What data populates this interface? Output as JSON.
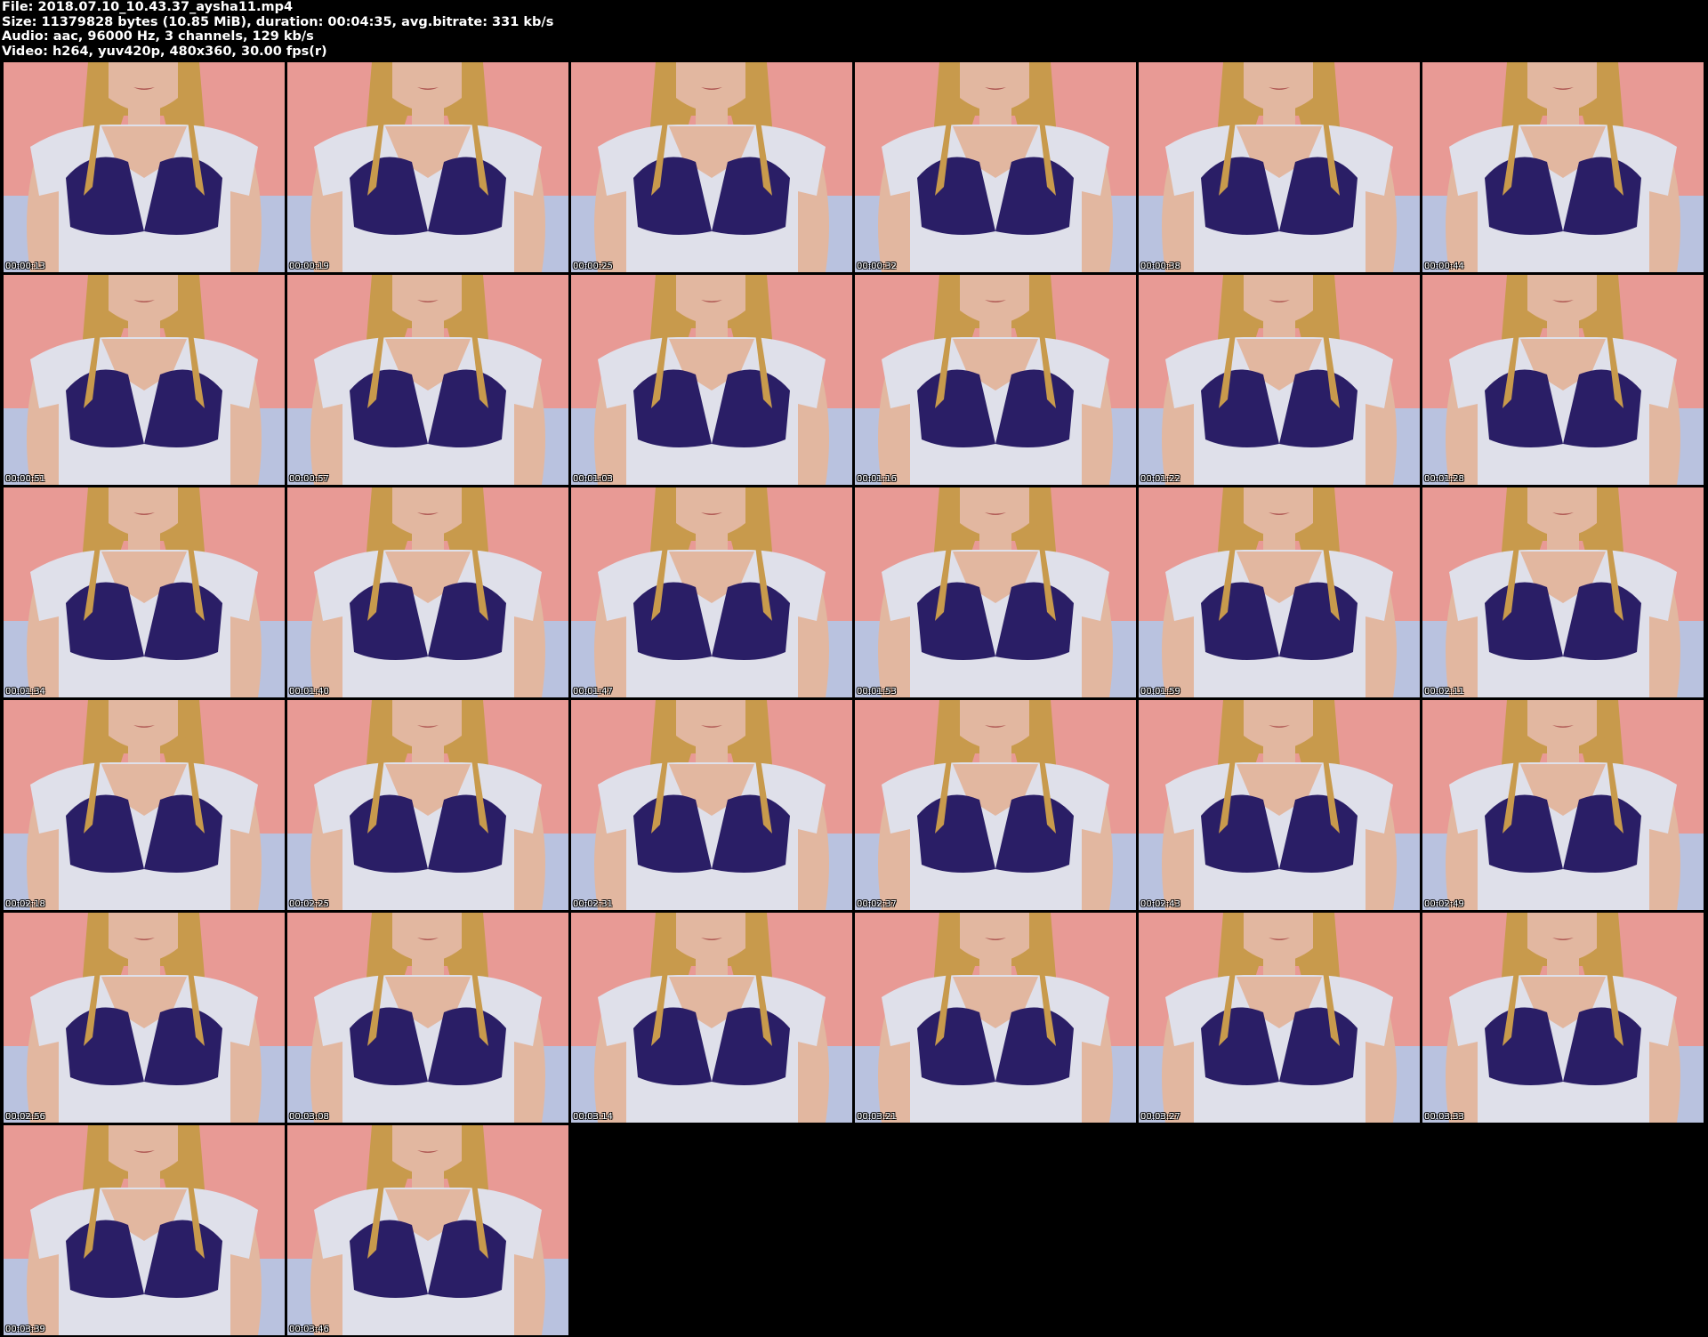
{
  "header": {
    "file_line": "File: 2018.07.10_10.43.37_aysha11.mp4",
    "size_line": "Size: 11379828 bytes (10.85 MiB), duration: 00:04:35, avg.bitrate: 331 kb/s",
    "audio_line": "Audio: aac, 96000 Hz, 3 channels, 129 kb/s",
    "video_line": "Video: h264, yuv420p, 480x360, 30.00 fps(r)"
  },
  "colors": {
    "background": "#000000",
    "header_text": "#ffffff",
    "wall": "#e89a95",
    "shirt": "#dfe0ea",
    "bra": "#2a1e66",
    "hair": "#c89a4c",
    "skin": "#e2b7a0"
  },
  "thumbnails": [
    {
      "timestamp": "00:00:13"
    },
    {
      "timestamp": "00:00:19"
    },
    {
      "timestamp": "00:00:25"
    },
    {
      "timestamp": "00:00:32"
    },
    {
      "timestamp": "00:00:38"
    },
    {
      "timestamp": "00:00:44"
    },
    {
      "timestamp": "00:00:51"
    },
    {
      "timestamp": "00:00:57"
    },
    {
      "timestamp": "00:01:03"
    },
    {
      "timestamp": "00:01:16"
    },
    {
      "timestamp": "00:01:22"
    },
    {
      "timestamp": "00:01:28"
    },
    {
      "timestamp": "00:01:34"
    },
    {
      "timestamp": "00:01:40"
    },
    {
      "timestamp": "00:01:47"
    },
    {
      "timestamp": "00:01:53"
    },
    {
      "timestamp": "00:01:59"
    },
    {
      "timestamp": "00:02:11"
    },
    {
      "timestamp": "00:02:18"
    },
    {
      "timestamp": "00:02:25"
    },
    {
      "timestamp": "00:02:31"
    },
    {
      "timestamp": "00:02:37"
    },
    {
      "timestamp": "00:02:43"
    },
    {
      "timestamp": "00:02:49"
    },
    {
      "timestamp": "00:02:56"
    },
    {
      "timestamp": "00:03:08"
    },
    {
      "timestamp": "00:03:14"
    },
    {
      "timestamp": "00:03:21"
    },
    {
      "timestamp": "00:03:27"
    },
    {
      "timestamp": "00:03:33"
    },
    {
      "timestamp": "00:03:39"
    },
    {
      "timestamp": "00:03:46"
    }
  ]
}
